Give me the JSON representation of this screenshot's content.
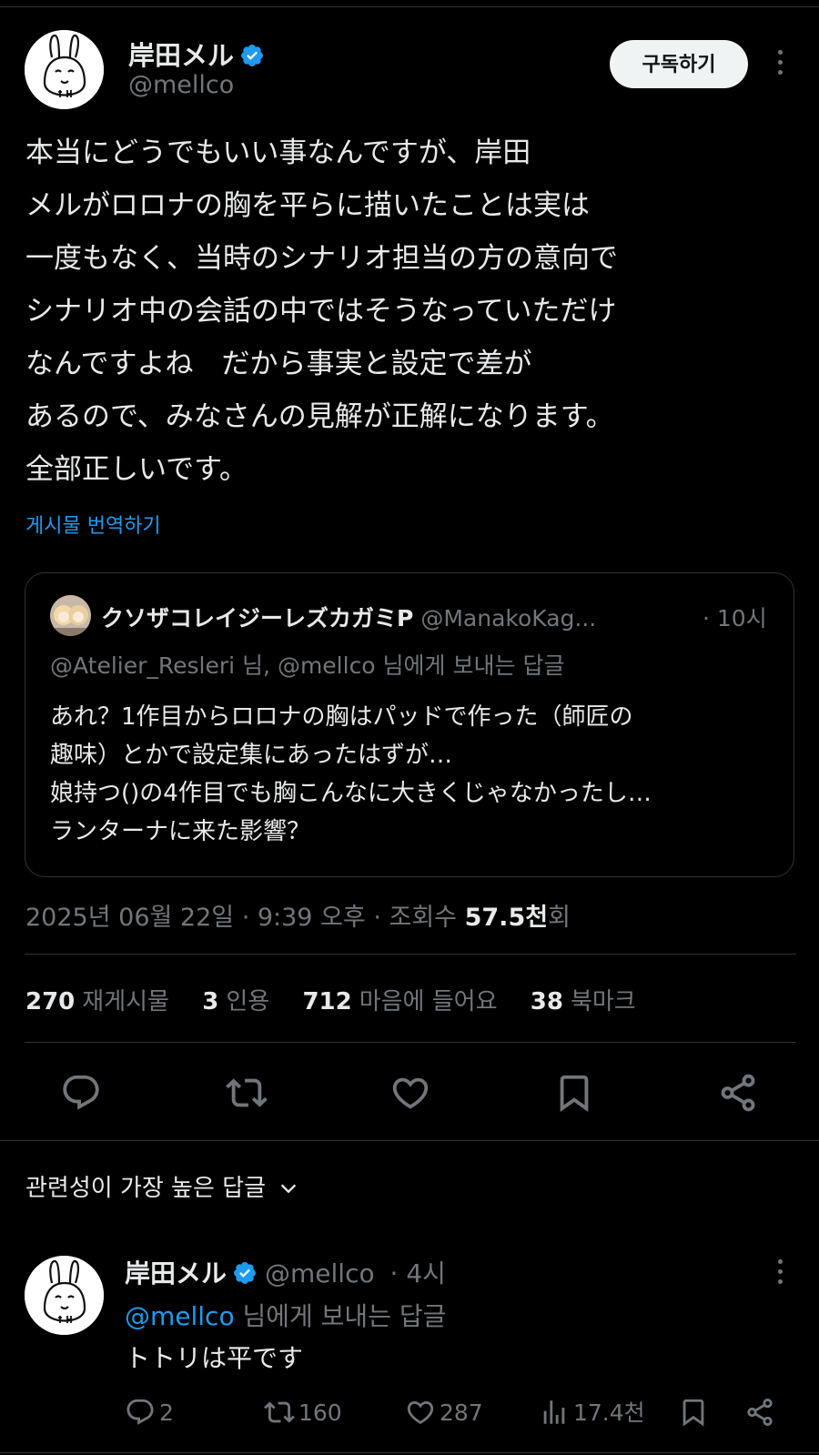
{
  "author": {
    "name": "岸田メル",
    "handle": "@mellco",
    "verified": true
  },
  "subscribe_label": "구독하기",
  "tweet": {
    "lines": [
      "本当にどうでもいい事なんですが、岸田",
      "メルがロロナの胸を平らに描いたことは実は",
      "一度もなく、当時のシナリオ担当の方の意向で",
      "シナリオ中の会話の中ではそうなっていただけ",
      "なんですよね　だから事実と設定で差が",
      "あるので、みなさんの見解が正解になります。",
      "全部正しいです。"
    ],
    "translate_label": "게시물 번역하기"
  },
  "quote": {
    "name": "クソザコレイジーレズカガミP",
    "handle": "@ManakoKag...",
    "time": "· 10시",
    "replying": "@Atelier_Resleri 님, @mellco 님에게 보내는 답글",
    "lines": [
      "あれ？1作目からロロナの胸はパッドで作った（師匠の",
      "趣味）とかで設定集にあったはずが…",
      "娘持つ()の4作目でも胸こんなに大きくじゃなかったし…",
      "ランターナに来た影響？"
    ]
  },
  "meta": {
    "timestamp": "2025년 06월 22일 · 9:39 오후 · 조회수 ",
    "views": "57.5천",
    "views_suffix": "회"
  },
  "stats": {
    "reposts_count": "270",
    "reposts_label": "재게시물",
    "quotes_count": "3",
    "quotes_label": "인용",
    "likes_count": "712",
    "likes_label": "마음에 들어요",
    "bookmarks_count": "38",
    "bookmarks_label": "북마크"
  },
  "sort_label": "관련성이 가장 높은 답글",
  "reply": {
    "name": "岸田メル",
    "handle": "@mellco",
    "time": "· 4시",
    "replying_mention": "@mellco",
    "replying_suffix": " 님에게 보내는 답글",
    "text": "トトリは平です",
    "replies": "2",
    "reposts": "160",
    "likes": "287",
    "views": "17.4천"
  },
  "colors": {
    "background": "#000000",
    "text": "#e7e9ea",
    "muted": "#71767b",
    "accent": "#1d9bf0",
    "border": "#2f3336"
  },
  "icons": [
    "verified-badge-icon",
    "more-icon",
    "reply-icon",
    "repost-icon",
    "like-icon",
    "bookmark-icon",
    "share-icon",
    "views-icon",
    "chevron-down-icon"
  ]
}
